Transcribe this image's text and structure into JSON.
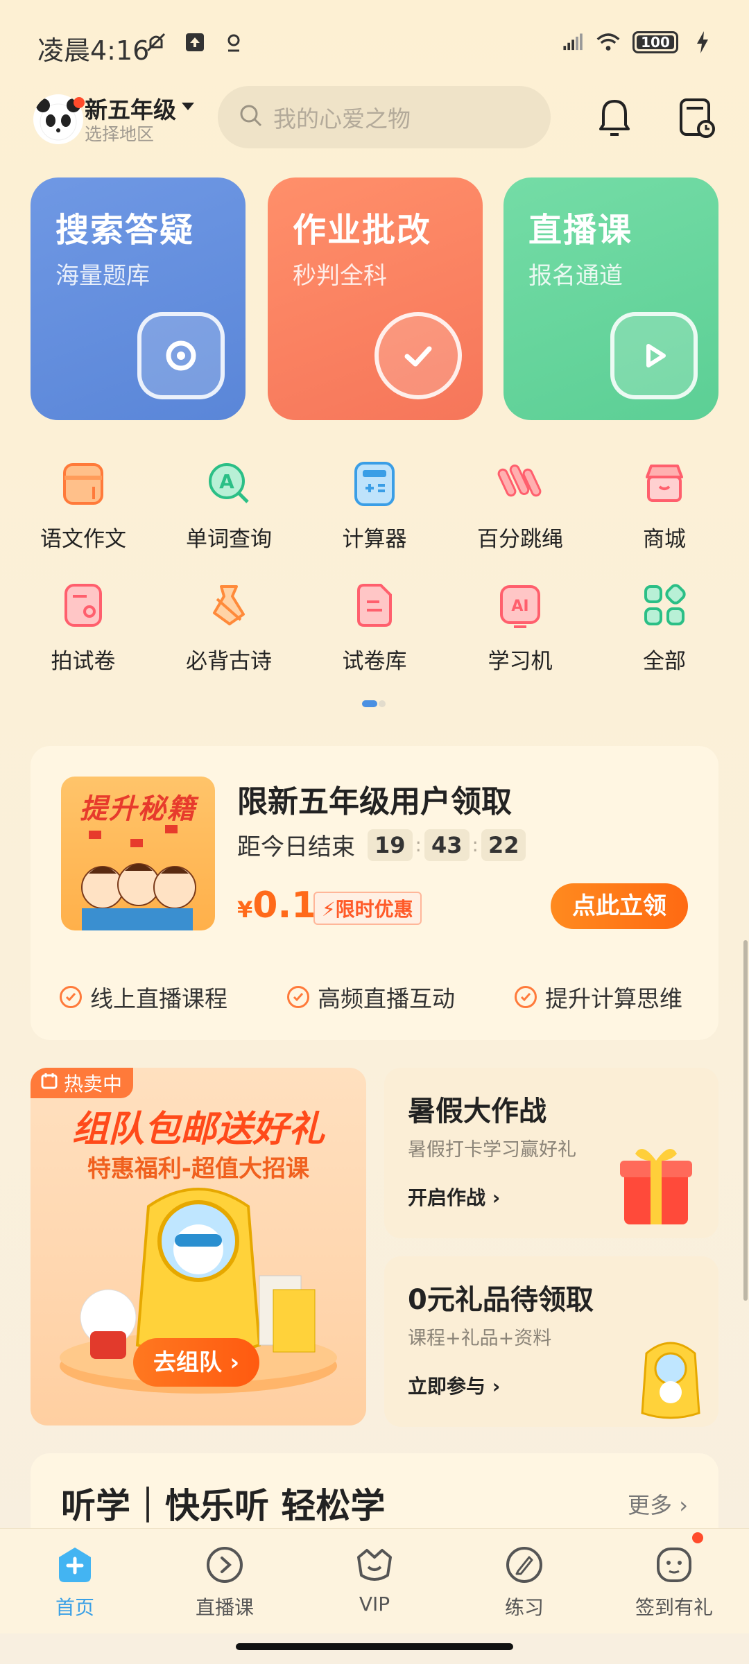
{
  "status_bar": {
    "time": "凌晨4:16",
    "battery": "100"
  },
  "header": {
    "grade": "新五年级",
    "region": "选择地区",
    "search_placeholder": "我的心爱之物"
  },
  "big_cards": [
    {
      "title": "搜索答疑",
      "subtitle": "海量题库",
      "icon": "camera-icon",
      "color": "#6f98e4"
    },
    {
      "title": "作业批改",
      "subtitle": "秒判全科",
      "icon": "check-icon",
      "color": "#ff8f6a"
    },
    {
      "title": "直播课",
      "subtitle": "报名通道",
      "icon": "play-icon",
      "color": "#74dca6"
    }
  ],
  "tools": [
    {
      "label": "语文作文",
      "icon": "notebook-icon"
    },
    {
      "label": "单词查询",
      "icon": "word-search-icon"
    },
    {
      "label": "计算器",
      "icon": "calculator-icon"
    },
    {
      "label": "百分跳绳",
      "icon": "jump-rope-icon"
    },
    {
      "label": "商城",
      "icon": "store-icon"
    },
    {
      "label": "拍试卷",
      "icon": "scan-paper-icon"
    },
    {
      "label": "必背古诗",
      "icon": "poetry-icon"
    },
    {
      "label": "试卷库",
      "icon": "paper-library-icon"
    },
    {
      "label": "学习机",
      "icon": "ai-tablet-icon"
    },
    {
      "label": "全部",
      "icon": "grid-icon"
    }
  ],
  "promo": {
    "image_text": "提升秘籍",
    "title": "限新五年级用户领取",
    "countdown_label": "距今日结束",
    "hours": "19",
    "minutes": "43",
    "seconds": "22",
    "currency": "¥",
    "price": "0.1",
    "deal_tag": "限时优惠",
    "claim_button": "点此立领",
    "features": [
      "线上直播课程",
      "高频直播互动",
      "提升计算思维"
    ]
  },
  "banner": {
    "tag": "热卖中",
    "title": "组队包邮送好礼",
    "subtitle": "特惠福利-超值大招课",
    "button": "去组队 ›"
  },
  "side_cards": [
    {
      "title": "暑假大作战",
      "subtitle": "暑假打卡学习赢好礼",
      "link": "开启作战 ›"
    },
    {
      "title": "0元礼品待领取",
      "subtitle": "课程+礼品+资料",
      "link": "立即参与 ›"
    }
  ],
  "listen": {
    "title": "听学｜快乐听 轻松学",
    "more": "更多 ›"
  },
  "bottom_nav": [
    {
      "label": "首页",
      "icon": "home-icon",
      "active": true
    },
    {
      "label": "直播课",
      "icon": "live-play-icon",
      "active": false
    },
    {
      "label": "VIP",
      "icon": "vip-icon",
      "active": false
    },
    {
      "label": "练习",
      "icon": "practice-icon",
      "active": false
    },
    {
      "label": "签到有礼",
      "icon": "checkin-icon",
      "active": false
    }
  ],
  "colors": {
    "accent_orange": "#ff6a12",
    "nav_active": "#3aa0e6",
    "background": "#fdf0d3"
  }
}
